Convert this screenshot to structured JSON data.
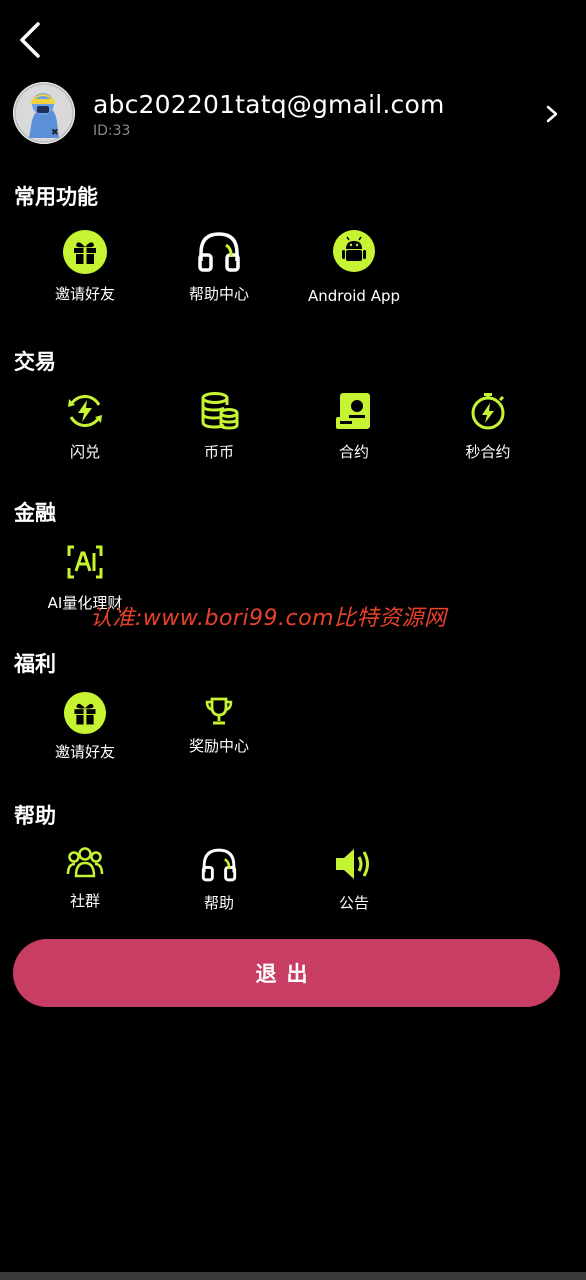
{
  "header": {
    "back_icon": "chevron-left-icon"
  },
  "profile": {
    "email": "abc202201tatq@gmail.com",
    "id_text": "ID:33",
    "avatar": "avatar-astronaut",
    "arrow_icon": "chevron-right-icon"
  },
  "sections": {
    "common": {
      "title": "常用功能",
      "items": [
        {
          "label": "邀请好友",
          "icon": "gift-icon"
        },
        {
          "label": "帮助中心",
          "icon": "headphones-icon"
        },
        {
          "label": "Android App",
          "icon": "android-icon"
        }
      ]
    },
    "trade": {
      "title": "交易",
      "items": [
        {
          "label": "闪兑",
          "icon": "flash-swap-icon"
        },
        {
          "label": "币币",
          "icon": "coins-icon"
        },
        {
          "label": "合约",
          "icon": "contract-icon"
        },
        {
          "label": "秒合约",
          "icon": "stopwatch-icon"
        }
      ]
    },
    "finance": {
      "title": "金融",
      "items": [
        {
          "label": "AI量化理财",
          "icon": "ai-icon"
        }
      ]
    },
    "welfare": {
      "title": "福利",
      "items": [
        {
          "label": "邀请好友",
          "icon": "gift-icon"
        },
        {
          "label": "奖励中心",
          "icon": "trophy-icon"
        }
      ]
    },
    "help": {
      "title": "帮助",
      "items": [
        {
          "label": "社群",
          "icon": "community-icon"
        },
        {
          "label": "帮助",
          "icon": "headphones-icon"
        },
        {
          "label": "公告",
          "icon": "speaker-icon"
        }
      ]
    }
  },
  "watermark": "认准:www.bori99.com比特资源网",
  "logout_label": "退出",
  "colors": {
    "accent": "#c6f432",
    "logout": "#c83d63",
    "background": "#000000",
    "watermark": "#e8432a"
  }
}
